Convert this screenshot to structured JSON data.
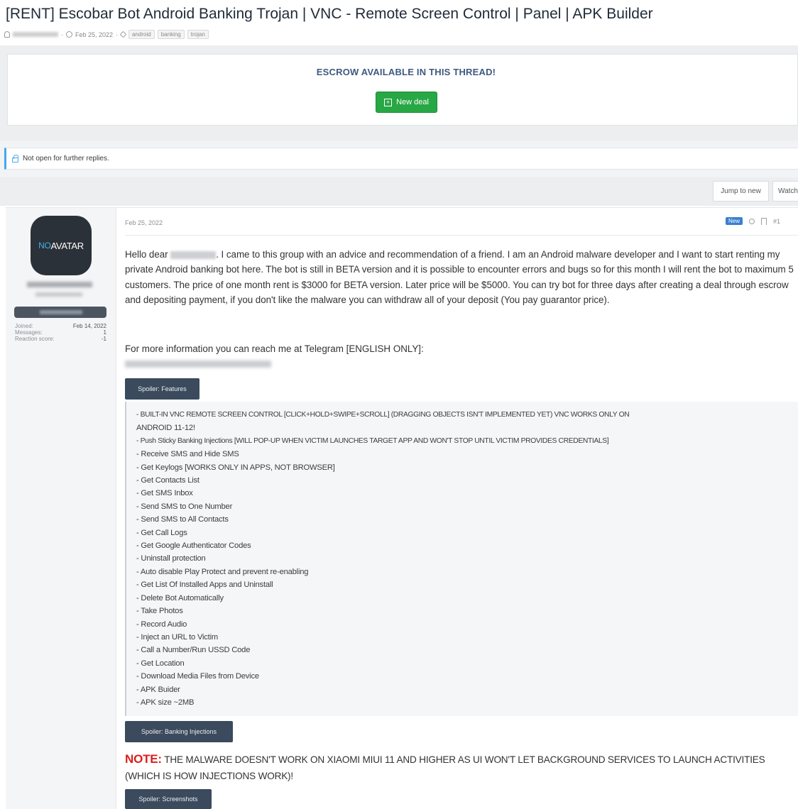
{
  "thread": {
    "title": "[RENT] Escobar Bot Android Banking Trojan | VNC - Remote Screen Control | Panel | APK Builder",
    "date": "Feb 25, 2022",
    "tags": [
      "android",
      "banking",
      "trojan"
    ]
  },
  "escrow": {
    "title": "ESCROW AVAILABLE IN THIS THREAD!",
    "button_icon": "plus-square-icon",
    "button_label": "New deal",
    "button_color": "#28a745"
  },
  "notice": {
    "text": "Not open for further replies.",
    "icon": "lock-icon"
  },
  "nav": {
    "jump_label": "Jump to new",
    "watch_label": "Watch"
  },
  "author": {
    "avatar_text_no": "NO",
    "avatar_text_rest": "AVATAR",
    "stats": [
      {
        "label": "Joined:",
        "value": "Feb 14, 2022"
      },
      {
        "label": "Messages:",
        "value": "1"
      },
      {
        "label": "Reaction score:",
        "value": "-1"
      }
    ]
  },
  "post": {
    "date": "Feb 25, 2022",
    "badge": "New",
    "number": "#1",
    "greeting_prefix": "Hello dear",
    "body_rest": ". I came to this group with an advice and recommendation of a friend. I am an Android malware developer and I want to start renting my private Android banking bot here. The bot is still in BETA version and it is possible to encounter errors and bugs so for this month I will rent the bot to maximum 5 customers. The price of one month rent is $3000 for BETA version. Later price will be $5000. You can try bot for three days after creating a deal through escrow and depositing payment, if you don't like the malware you can withdraw all of your deposit (You pay guarantor price).",
    "more_info": "For more information you can reach me at Telegram [ENGLISH ONLY]:",
    "spoiler_features": "Spoiler: Features",
    "features": [
      "- BUILT-IN VNC REMOTE SCREEN CONTROL [CLICK+HOLD+SWIPE+SCROLL] (DRAGGING OBJECTS ISN'T IMPLEMENTED YET) VNC WORKS ONLY ON",
      "ANDROID 11-12!",
      "- Push Sticky Banking Injections [WILL POP-UP WHEN VICTIM LAUNCHES TARGET APP AND WON'T STOP UNTIL VICTIM PROVIDES CREDENTIALS]",
      "- Receive SMS and Hide SMS",
      "- Get Keylogs [WORKS ONLY IN APPS, NOT BROWSER]",
      "- Get Contacts List",
      "- Get SMS Inbox",
      "- Send SMS to One Number",
      "- Send SMS to All Contacts",
      "- Get Call Logs",
      "- Get Google Authenticator Codes",
      "- Uninstall protection",
      "- Auto disable Play Protect and prevent re-enabling",
      "- Get List Of Installed Apps and Uninstall",
      "- Delete Bot Automatically",
      "- Take Photos",
      "- Record Audio",
      "- Inject an URL to Victim",
      "- Call a Number/Run USSD Code",
      "- Get Location",
      "- Download Media Files from Device",
      "- APK Buider",
      "- APK size ~2MB"
    ],
    "spoiler_injections": "Spoiler: Banking Injections",
    "note_label": "NOTE:",
    "note_text": " THE MALWARE DOESN'T WORK ON XIAOMI MIUI 11 AND HIGHER AS UI WON'T LET BACKGROUND SERVICES TO LAUNCH ACTIVITIES (WHICH IS HOW INJECTIONS WORK)!",
    "spoiler_screenshots": "Spoiler: Screenshots"
  }
}
